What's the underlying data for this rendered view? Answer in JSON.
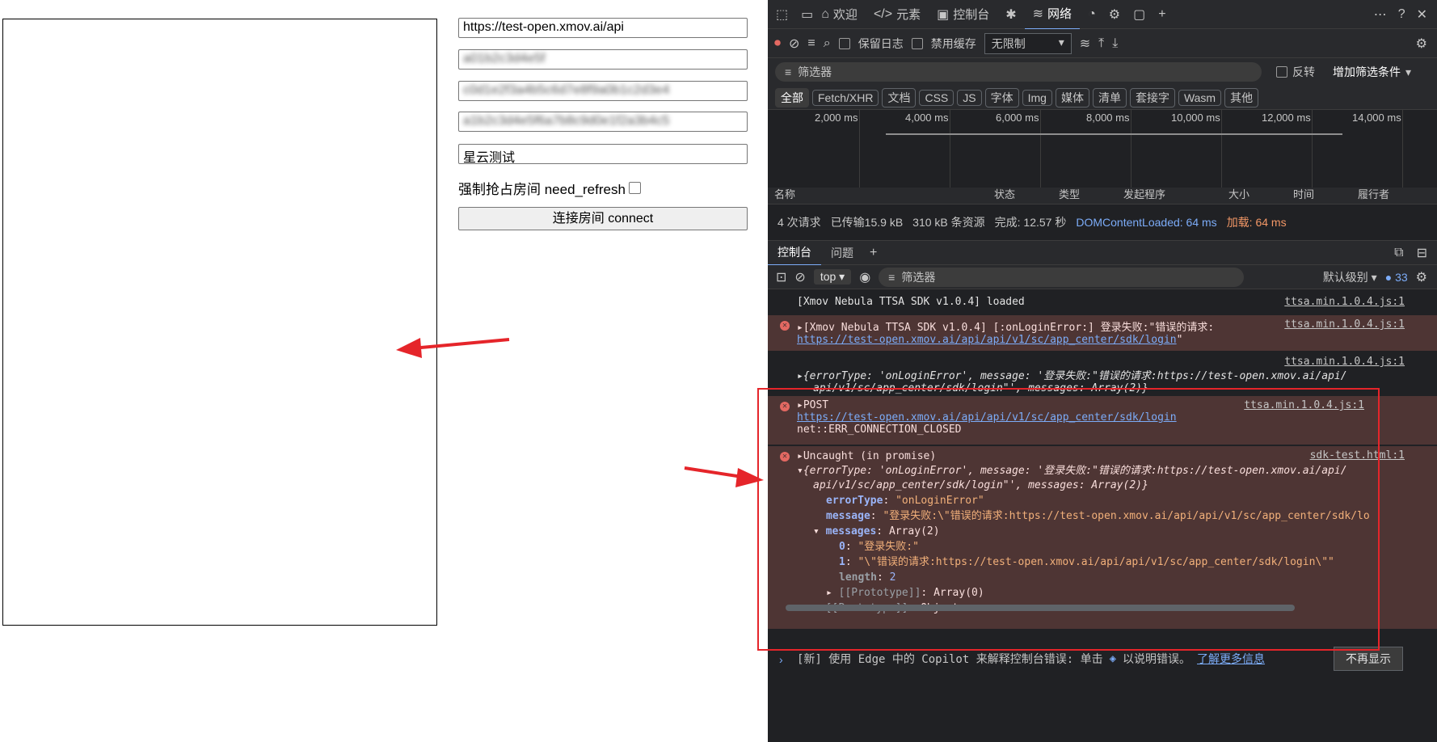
{
  "left_page": {
    "fields": [
      {
        "value": "https://test-open.xmov.ai/api",
        "blurred": false
      },
      {
        "value": "a01b2c3d4e5f",
        "blurred": true
      },
      {
        "value": "c0d1e2f3a4b5c6d7e8f9a0b1c2d3e4",
        "blurred": true
      },
      {
        "value": "a1b2c3d4e5f6a7b8c9d0e1f2a3b4c5",
        "blurred": true
      },
      {
        "value": "星云测试",
        "blurred": false
      }
    ],
    "checkbox_label": "强制抢占房间 need_refresh",
    "connect_button": "连接房间 connect"
  },
  "devtools": {
    "top_tabs": [
      {
        "icon": "home-icon",
        "label": "欢迎"
      },
      {
        "icon": "elements-icon",
        "label": "元素"
      },
      {
        "icon": "console-icon",
        "label": "控制台"
      },
      {
        "icon": "bug-icon",
        "label": ""
      },
      {
        "icon": "wifi-icon",
        "label": "网络"
      }
    ],
    "preserve_log": "保留日志",
    "disable_cache": "禁用缓存",
    "throttle": "无限制",
    "filter_placeholder": "筛选器",
    "invert": "反转",
    "more_filters": "增加筛选条件",
    "chips": [
      "全部",
      "Fetch/XHR",
      "文档",
      "CSS",
      "JS",
      "字体",
      "Img",
      "媒体",
      "清单",
      "套接字",
      "Wasm",
      "其他"
    ],
    "timeline_ticks": [
      "2,000 ms",
      "4,000 ms",
      "6,000 ms",
      "8,000 ms",
      "10,000 ms",
      "12,000 ms",
      "14,000 ms"
    ],
    "columns": [
      "名称",
      "状态",
      "类型",
      "发起程序",
      "大小",
      "时间",
      "履行者"
    ],
    "summary": {
      "requests": "4 次请求",
      "transferred": "已传输15.9 kB",
      "resources": "310 kB 条资源",
      "finish": "完成: 12.57 秒",
      "dcl": "DOMContentLoaded: 64 ms",
      "load": "加载: 64 ms"
    },
    "console_tabs": [
      "控制台",
      "问题"
    ],
    "console_context": "top",
    "console_filter": "筛选器",
    "default_levels": "默认级别",
    "issue_count": "33",
    "messages": {
      "m1_text": "[Xmov Nebula TTSA SDK v1.0.4] loaded",
      "m1_src": "ttsa.min.1.0.4.js:1",
      "m2_text": "[Xmov Nebula TTSA SDK v1.0.4] [:onLoginError:] 登录失败:\"错误的请求:",
      "m2_link": "https://test-open.xmov.ai/api/api/v1/sc/app_center/sdk/login",
      "m2_end": "\"",
      "m2_src": "ttsa.min.1.0.4.js:1",
      "m3_line1": "{errorType: 'onLoginError', message: '登录失败:\"错误的请求:https://test-open.xmov.ai/api/",
      "m3_line2": "api/v1/sc/app_center/sdk/login\"', messages: Array(2)}",
      "m3_src": "ttsa.min.1.0.4.js:1",
      "m4_method": "POST",
      "m4_link": "https://test-open.xmov.ai/api/api/v1/sc/app_center/sdk/login",
      "m4_err": "net::ERR_CONNECTION_CLOSED",
      "m4_src": "ttsa.min.1.0.4.js:1",
      "m5_title": "Uncaught (in promise)",
      "m5_src": "sdk-test.html:1",
      "m5_line1": "{errorType: 'onLoginError', message: '登录失败:\"错误的请求:https://test-open.xmov.ai/api/",
      "m5_line2": "api/v1/sc/app_center/sdk/login\"', messages: Array(2)}",
      "k_errorType": "errorType",
      "v_errorType": "\"onLoginError\"",
      "k_message": "message",
      "v_message": "\"登录失败:\\\"错误的请求:https://test-open.xmov.ai/api/api/v1/sc/app_center/sdk/lo",
      "k_messages": "messages",
      "v_messages": "Array(2)",
      "k_0": "0",
      "v_0": "\"登录失败:\"",
      "k_1": "1",
      "v_1": "\"\\\"错误的请求:https://test-open.xmov.ai/api/api/v1/sc/app_center/sdk/login\\\"\"",
      "k_length": "length",
      "v_length": "2",
      "proto_array": "[[Prototype]]",
      "proto_array_val": "Array(0)",
      "proto_obj": "[[Prototype]]",
      "proto_obj_val": "Object"
    },
    "footer": {
      "text": "[新] 使用 Edge 中的 Copilot 来解释控制台错误: 单击",
      "text2": "以说明错误。",
      "link": "了解更多信息",
      "button": "不再显示"
    }
  },
  "colors": {
    "devtools_bg": "#202124",
    "error_bg": "#4e3534",
    "annotation_red": "#e5252a"
  }
}
